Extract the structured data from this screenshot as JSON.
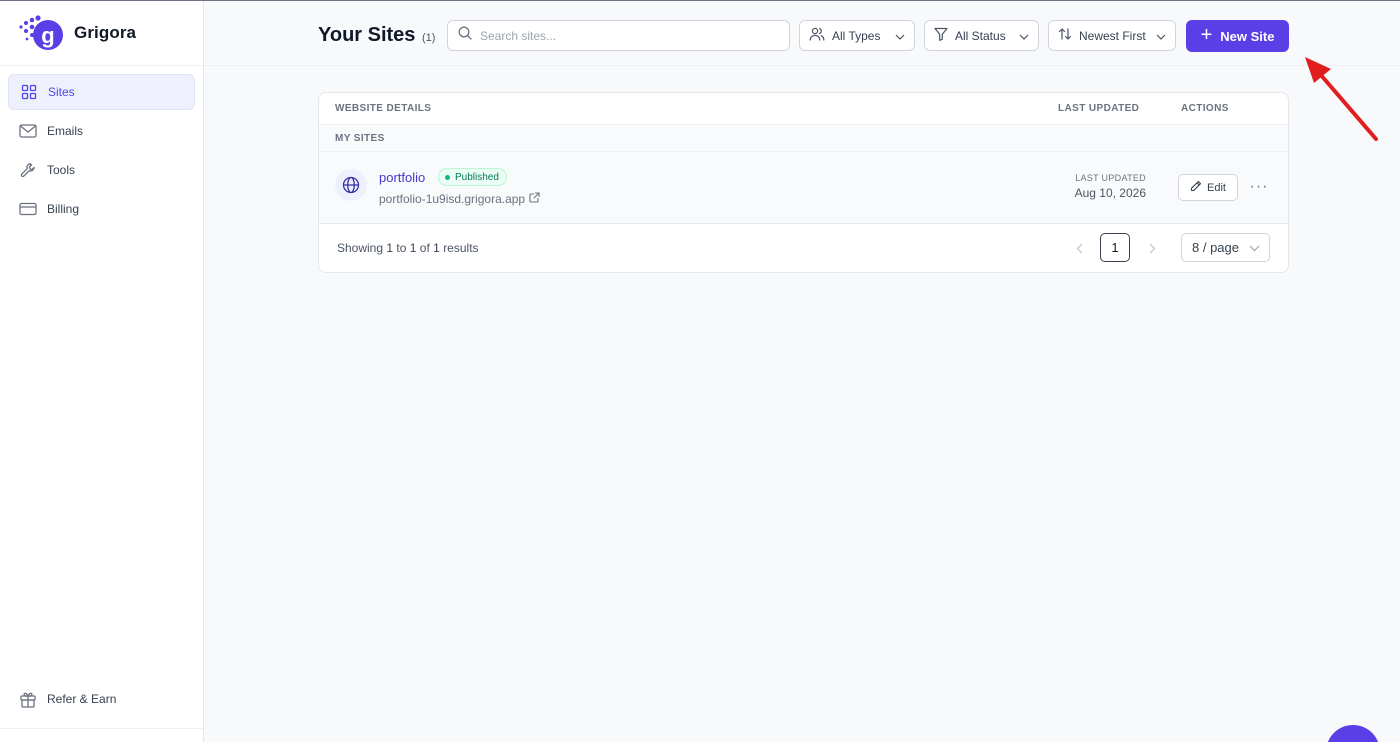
{
  "brand": {
    "name": "Grigora"
  },
  "sidebar": {
    "items": [
      {
        "label": "Sites",
        "icon": "grid-icon",
        "active": true
      },
      {
        "label": "Emails",
        "icon": "mail-icon"
      },
      {
        "label": "Tools",
        "icon": "wrench-icon"
      },
      {
        "label": "Billing",
        "icon": "credit-card-icon"
      }
    ],
    "bottom": {
      "label": "Refer & Earn",
      "icon": "gift-icon"
    }
  },
  "header": {
    "title": "Your Sites",
    "count": "(1)",
    "search_placeholder": "Search sites...",
    "search_value": "",
    "filter_type": "All Types",
    "filter_status": "All Status",
    "sort": "Newest First",
    "new_site_label": "New Site"
  },
  "table": {
    "col_details": "WEBSITE DETAILS",
    "col_updated": "LAST UPDATED",
    "col_actions": "ACTIONS",
    "group_label": "MY SITES",
    "rows": [
      {
        "name": "portfolio",
        "status": "Published",
        "url": "portfolio-1u9isd.grigora.app",
        "updated_label": "LAST UPDATED",
        "updated_date": "Aug 10, 2026",
        "edit_label": "Edit",
        "more_label": "···"
      }
    ],
    "footer": {
      "showing_prefix": "Showing",
      "from": "1",
      "to_word": "to",
      "to": "1",
      "of_word": "of",
      "total": "1",
      "results_word": "results",
      "current_page": "1",
      "per_page": "8 / page"
    }
  },
  "colors": {
    "accent": "#5b3fe6",
    "link": "#4338ca",
    "published": "#10b981",
    "annotation": "#e11d1d"
  }
}
